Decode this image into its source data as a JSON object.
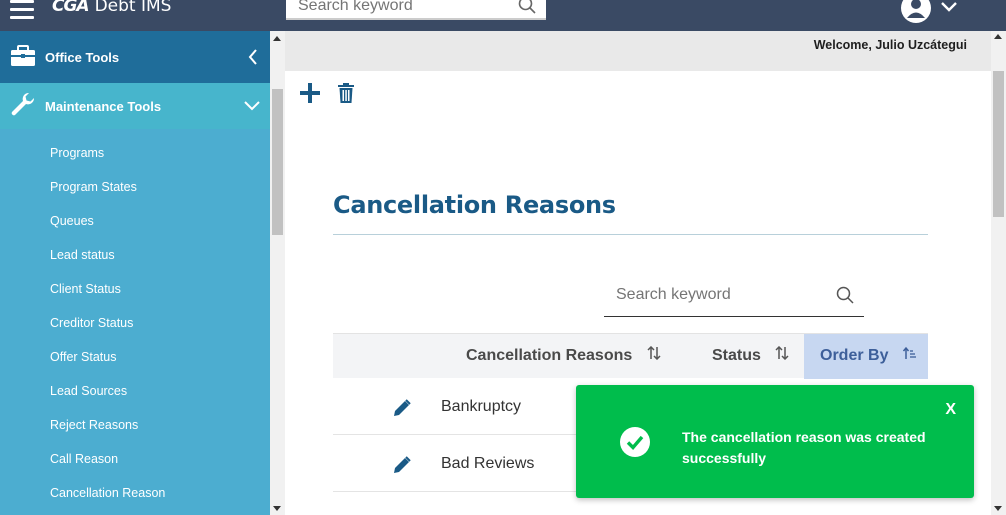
{
  "header": {
    "logo_brand": "CGA",
    "app_name": "Debt IMS",
    "search_placeholder": "Search keyword"
  },
  "sidebar": {
    "office_tools": "Office Tools",
    "maintenance_tools": "Maintenance Tools",
    "items": [
      {
        "label": "Programs"
      },
      {
        "label": "Program States"
      },
      {
        "label": "Queues"
      },
      {
        "label": "Lead status"
      },
      {
        "label": "Client Status"
      },
      {
        "label": "Creditor Status"
      },
      {
        "label": "Offer Status"
      },
      {
        "label": "Lead Sources"
      },
      {
        "label": "Reject Reasons"
      },
      {
        "label": "Call Reason"
      },
      {
        "label": "Cancellation Reason"
      }
    ]
  },
  "welcome_text": "Welcome, Julio Uzcátegui",
  "page": {
    "title": "Cancellation Reasons",
    "search_placeholder": "Search keyword"
  },
  "table": {
    "columns": {
      "reason": "Cancellation Reasons",
      "status": "Status",
      "order": "Order By"
    },
    "rows": [
      {
        "name": "Bankruptcy"
      },
      {
        "name": "Bad Reviews"
      }
    ]
  },
  "toast": {
    "message": "The cancellation reason was created successfully",
    "close_label": "X"
  },
  "colors": {
    "topbar": "#3a4a64",
    "sidebar": "#4cadd0",
    "office_tools_bg": "#1f6d9a",
    "accent": "#1a5a86",
    "toast": "#00bd4c",
    "sorted_column": "#c7d7f1"
  },
  "icons": {
    "menu": "hamburger-icon",
    "search": "search-icon",
    "user": "user-avatar-icon",
    "add": "plus-icon",
    "delete": "trash-icon",
    "edit": "pencil-icon",
    "success": "check-circle-icon"
  }
}
